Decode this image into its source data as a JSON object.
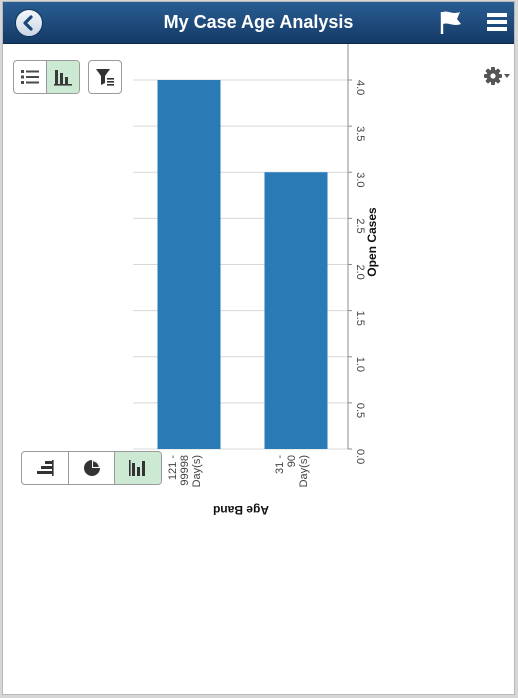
{
  "header": {
    "title": "My Case Age Analysis",
    "icons": [
      "back-icon",
      "flag-icon",
      "menu-icon"
    ]
  },
  "toolbar": {
    "view_modes": [
      {
        "name": "list-view",
        "icon": "list-icon",
        "active": false
      },
      {
        "name": "chart-view",
        "icon": "bar-chart-icon",
        "active": true
      }
    ],
    "filter_icon": "filter-icon",
    "settings_icon": "gear-icon"
  },
  "chart_type_selector": [
    {
      "name": "horizontal-bar",
      "icon": "horizontal-bar-icon",
      "active": false
    },
    {
      "name": "pie",
      "icon": "pie-icon",
      "active": false
    },
    {
      "name": "vertical-bar",
      "icon": "vertical-bar-icon",
      "active": true
    }
  ],
  "chart_data": {
    "type": "bar",
    "orientation": "rotated 90 degrees clockwise",
    "categories": [
      [
        "121 -",
        "99998",
        "Day(s)"
      ],
      [
        "31 -",
        "90",
        "Day(s)"
      ]
    ],
    "values": [
      4,
      3
    ],
    "xlabel": "Age Band",
    "ylabel": "Open Cases",
    "ylim": [
      0,
      4
    ],
    "y_ticks": [
      "0.0",
      "0.5",
      "1.0",
      "1.5",
      "2.0",
      "2.5",
      "3.0",
      "3.5",
      "4.0"
    ],
    "grid": true,
    "bar_color": "#2a7ab5"
  },
  "colors": {
    "header_top": "#2a5d93",
    "header_bottom": "#143a66",
    "active_segment": "#cbe9d3",
    "bar": "#2a7ab5"
  }
}
